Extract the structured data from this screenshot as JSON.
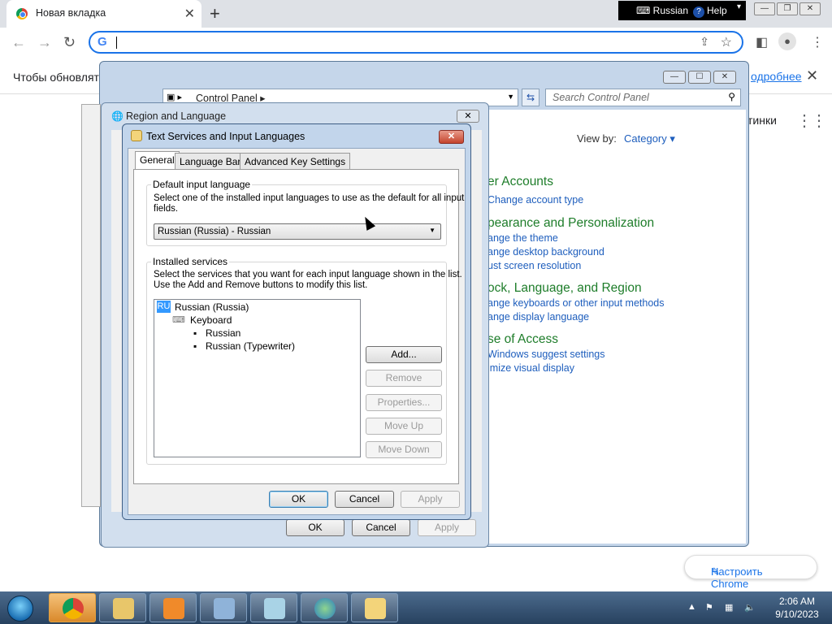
{
  "browser": {
    "tab_title": "Новая вкладка",
    "new_tab_symbol": "+",
    "omnibox_value": "",
    "infobar_message": "Чтобы обновлять",
    "infobar_link": "одробнее",
    "ntp_more": "тинки",
    "customize_label": "Настроить Chrome"
  },
  "language_bar": {
    "language": "Russian",
    "help": "Help"
  },
  "control_panel": {
    "breadcrumb": "Control Panel",
    "search_placeholder": "Search Control Panel",
    "view_by_label": "View by:",
    "view_by_value": "Category",
    "sections": [
      {
        "heading": "er Accounts",
        "links": [
          "Change account type"
        ]
      },
      {
        "heading": "pearance and Personalization",
        "links": [
          "ange the theme",
          "ange desktop background",
          "ust screen resolution"
        ]
      },
      {
        "heading": "ock, Language, and Region",
        "links": [
          "ange keyboards or other input methods",
          "ange display language"
        ]
      },
      {
        "heading": "se of Access",
        "links": [
          "Windows suggest settings",
          "imize visual display"
        ]
      }
    ]
  },
  "region_dialog": {
    "title": "Region and Language",
    "ok": "OK",
    "cancel": "Cancel",
    "apply": "Apply"
  },
  "text_services": {
    "title": "Text Services and Input Languages",
    "tabs": [
      "General",
      "Language Bar",
      "Advanced Key Settings"
    ],
    "default_group_label": "Default input language",
    "default_desc_line1": "Select one of the installed input languages to use as the default for all input",
    "default_desc_line2": "fields.",
    "default_value": "Russian (Russia) - Russian",
    "installed_group_label": "Installed services",
    "installed_desc_line1": "Select the services that you want for each input language shown in the list.",
    "installed_desc_line2": "Use the Add and Remove buttons to modify this list.",
    "tree": {
      "lang_code": "RU",
      "language": "Russian (Russia)",
      "category": "Keyboard",
      "items": [
        "Russian",
        "Russian (Typewriter)"
      ]
    },
    "buttons": {
      "add": "Add...",
      "remove": "Remove",
      "properties": "Properties...",
      "move_up": "Move Up",
      "move_down": "Move Down",
      "ok": "OK",
      "cancel": "Cancel",
      "apply": "Apply"
    }
  },
  "taskbar": {
    "time": "2:06 AM",
    "date": "9/10/2023"
  }
}
